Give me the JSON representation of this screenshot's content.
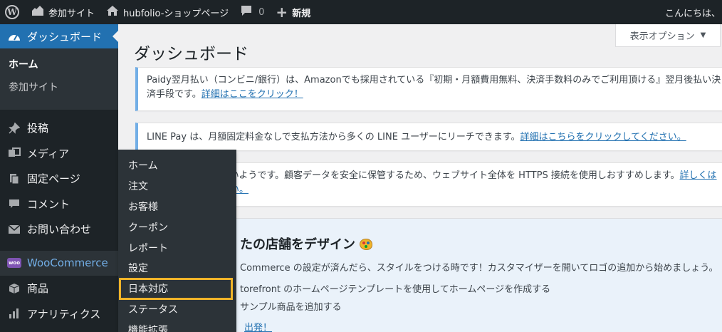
{
  "adminbar": {
    "wp_logo": "W",
    "site_label": "参加サイト",
    "home_label": "hubfolio-ショップページ",
    "comments_count": "0",
    "new_label": "新規",
    "greeting": "こんにちは、"
  },
  "sidebar": {
    "dashboard_label": "ダッシュボード",
    "submenu": [
      "ホーム",
      "参加サイト"
    ],
    "items": [
      "投稿",
      "メディア",
      "固定ページ",
      "コメント",
      "お問い合わせ"
    ],
    "woo_badge": "woo",
    "woocommerce_label": "WooCommerce",
    "items2": [
      "商品",
      "アナリティクス"
    ]
  },
  "flyout": {
    "items": [
      "ホーム",
      "注文",
      "お客様",
      "クーポン",
      "レポート",
      "設定",
      "日本対応",
      "ステータス",
      "機能拡張"
    ]
  },
  "content": {
    "screen_options": "表示オプション",
    "page_title": "ダッシュボード",
    "notice1_text": "Paidy翌月払い（コンビニ/銀行）は、Amazonでも採用されている『初期・月額費用無料、決済手数料のみでご利用頂ける』翌月後払い決済手段です。",
    "notice1_link": "詳細はここをクリック！",
    "notice2_text": "LINE Pay は、月額固定料金なしで支払方法から多くの LINE ユーザーにリーチできます。",
    "notice2_link": "詳細はこちらをクリックしてください。",
    "notice3_text": "続が使用されていないようです。顧客データを安全に保管するため、ウェブサイト全体を HTTPS 接続を使用しおすすめします。",
    "notice3_link": "詳しくはこちらをご覧ください。",
    "panel_title": "たの店舗をデザイン",
    "panel_desc": "Commerce の設定が済んだら、スタイルをつける時です！カスタマイザーを開いてロゴの追加から始めましょう。",
    "task1": "torefront のホームページテンプレートを使用してホームページを作成する",
    "task2": "サンプル商品を追加する",
    "panel_link": "出発！"
  },
  "colors": {
    "adminbar_bg": "#1d2327",
    "accent": "#2271b1",
    "highlight_border": "#f0b429",
    "notice_border": "#72aee6"
  }
}
